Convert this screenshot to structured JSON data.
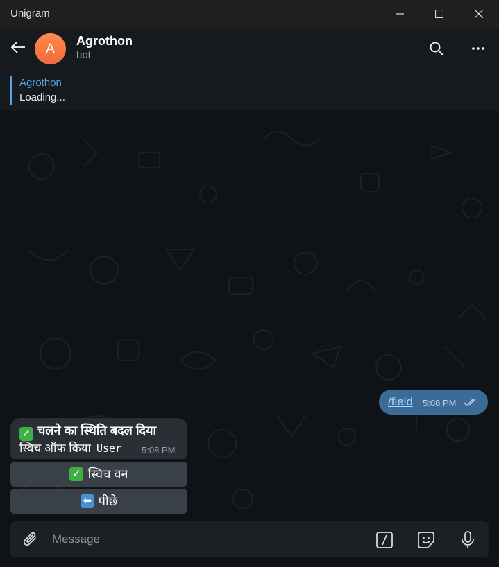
{
  "window": {
    "title": "Unigram"
  },
  "header": {
    "avatar_letter": "A",
    "name": "Agrothon",
    "status": "bot"
  },
  "pinned": {
    "title": "Agrothon",
    "text": "Loading..."
  },
  "messages": {
    "outgoing": {
      "text": "/field",
      "time": "5:08 PM"
    },
    "incoming": {
      "line1": "चलने का स्थिति बदल दिया",
      "line2": "स्विच ऑफ किया",
      "mono": "User",
      "time": "5:08 PM"
    }
  },
  "keyboard": {
    "button1": "स्विच वन",
    "button2": "पीछे"
  },
  "composer": {
    "placeholder": "Message"
  },
  "colors": {
    "accent": "#5aa4e6",
    "outgoing_bubble": "#3d6b98",
    "incoming_bubble": "#2a2f36",
    "avatar": "#f26a3b"
  }
}
